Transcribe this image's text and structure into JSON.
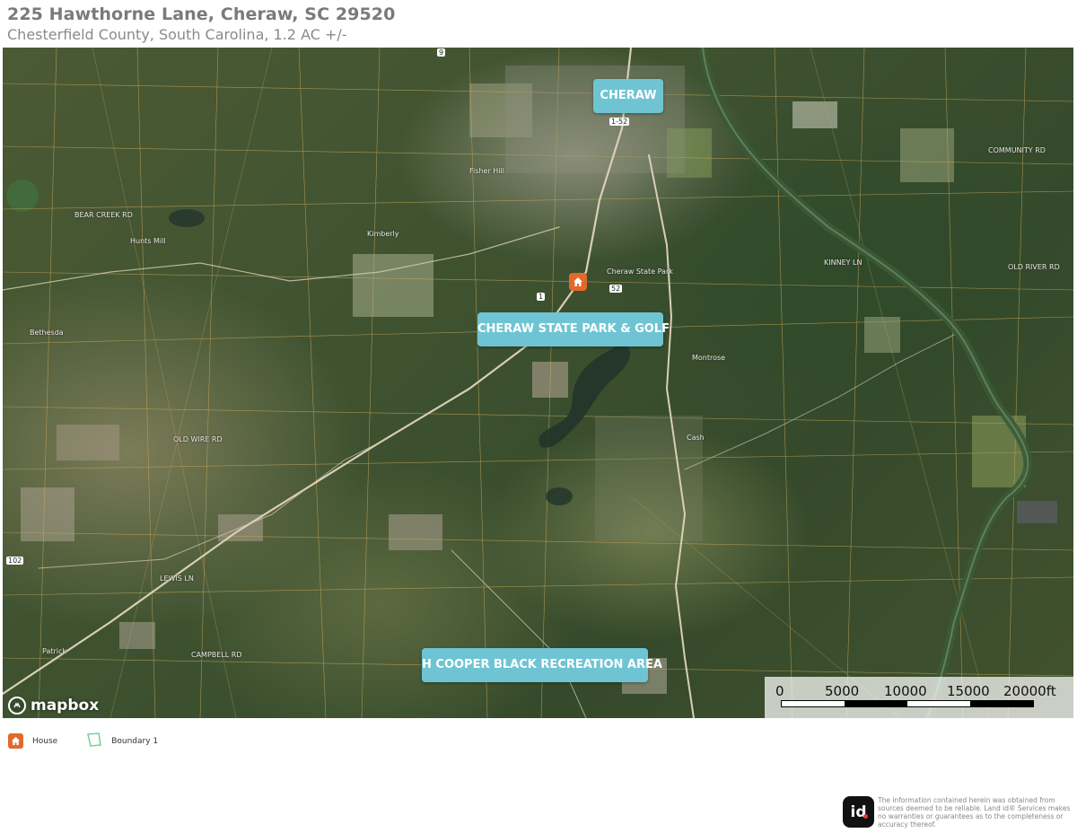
{
  "header": {
    "title": "225 Hawthorne Lane, Cheraw, SC 29520",
    "subtitle": "Chesterfield County, South Carolina, 1.2 AC +/-"
  },
  "map": {
    "callouts": [
      {
        "name": "cheraw",
        "label": "CHERAW"
      },
      {
        "name": "cheraw-state-park",
        "label": "CHERAW STATE PARK & GOLF"
      },
      {
        "name": "h-cooper-black",
        "label": "H COOPER BLACK RECREATION AREA"
      }
    ],
    "place_labels": [
      "Kimberly",
      "Hunts Mill",
      "Fisher Hill",
      "Bethesda",
      "Montrose",
      "Patrick",
      "Cash",
      "Cheraw State Park"
    ],
    "road_labels": [
      "OLD WIRE RD",
      "LEWIS LN",
      "CAMPBELL RD",
      "KINNEY LN",
      "COMMUNITY RD",
      "BEAR CREEK RD",
      "OLD RIVER RD"
    ],
    "route_shields": [
      "1",
      "52",
      "102",
      "1-52",
      "9"
    ],
    "attribution": "mapbox",
    "scale": {
      "labels": [
        "0",
        "5000",
        "10000",
        "15000",
        "20000ft"
      ]
    }
  },
  "legend": {
    "items": [
      {
        "label": "House",
        "icon": "house-icon",
        "color": "#e2692b"
      },
      {
        "label": "Boundary 1",
        "icon": "boundary-icon",
        "color": "#7fcf9a"
      }
    ]
  },
  "footer": {
    "logo_text": "id",
    "disclaimer": "The information contained herein was obtained from sources deemed to be reliable. Land id® Services makes no warranties or guarantees as to the completeness or accuracy thereof."
  },
  "colors": {
    "callout": "#6fc4d4",
    "house_pin": "#e2692b",
    "boundary": "#7fcf9a",
    "parcel_lines": "#c9a85a"
  }
}
